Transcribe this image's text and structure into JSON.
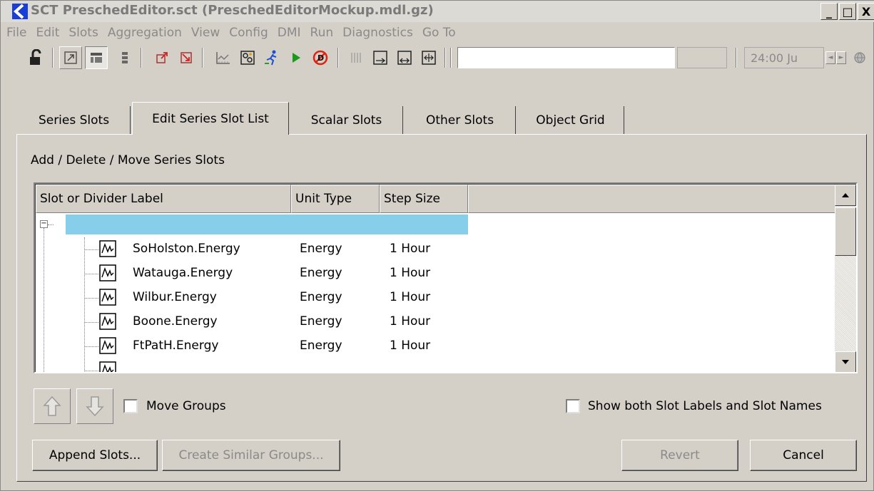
{
  "window": {
    "title": "SCT PreschedEditor.sct (PreschedEditorMockup.mdl.gz)",
    "minimize": "_",
    "maximize": "□",
    "close": "X"
  },
  "menu": [
    "File",
    "Edit",
    "Slots",
    "Aggregation",
    "View",
    "Config",
    "DMI",
    "Run",
    "Diagnostics",
    "Go To"
  ],
  "toolbar": {
    "date_value": "24:00 Ju",
    "spin_left": "◄",
    "spin_right": "►"
  },
  "tabs": [
    {
      "label": "Series Slots",
      "active": false
    },
    {
      "label": "Edit Series Slot List",
      "active": true
    },
    {
      "label": "Scalar Slots",
      "active": false
    },
    {
      "label": "Other Slots",
      "active": false
    },
    {
      "label": "Object Grid",
      "active": false
    }
  ],
  "panel": {
    "heading": "Add / Delete / Move Series Slots"
  },
  "table": {
    "columns": [
      "Slot or Divider Label",
      "Unit Type",
      "Step Size"
    ],
    "expander": "−",
    "rows": [
      {
        "name": "SoHolston.Energy",
        "unit": "Energy",
        "step": "1 Hour"
      },
      {
        "name": "Watauga.Energy",
        "unit": "Energy",
        "step": "1 Hour"
      },
      {
        "name": "Wilbur.Energy",
        "unit": "Energy",
        "step": "1 Hour"
      },
      {
        "name": "Boone.Energy",
        "unit": "Energy",
        "step": "1 Hour"
      },
      {
        "name": "FtPatH.Energy",
        "unit": "Energy",
        "step": "1 Hour"
      }
    ]
  },
  "controls": {
    "move_groups": "Move Groups",
    "show_both": "Show both Slot Labels and Slot Names",
    "append_slots": "Append Slots...",
    "create_similar": "Create Similar Groups...",
    "revert": "Revert",
    "cancel": "Cancel"
  },
  "colors": {
    "accent_selection": "#87ceeb",
    "window_bg": "#d4d0c8",
    "app_icon": "#1a3fd6"
  }
}
